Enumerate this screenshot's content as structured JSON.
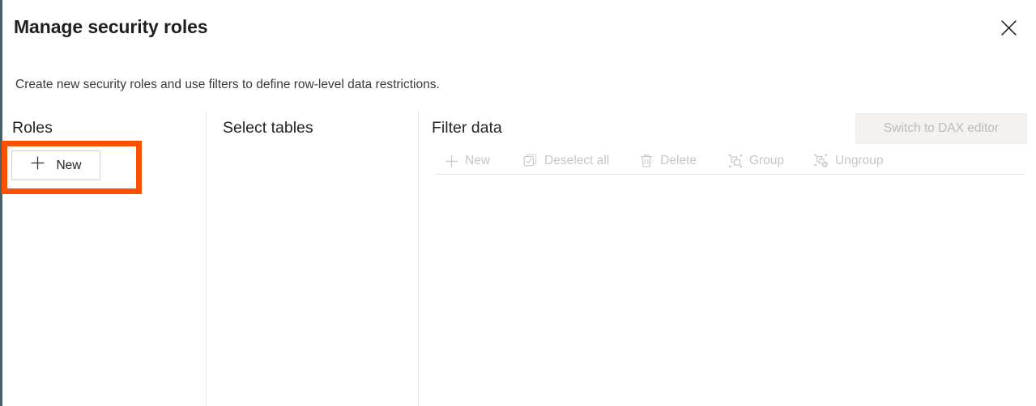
{
  "dialog": {
    "title": "Manage security roles",
    "subtitle": "Create new security roles and use filters to define row-level data restrictions.",
    "close_label": "Close",
    "close_icon": "close-icon",
    "accent_color": "#4b6069",
    "highlight_color": "#fa5000"
  },
  "columns": {
    "roles": {
      "heading": "Roles",
      "new_button": {
        "label": "New",
        "icon": "plus-icon"
      }
    },
    "tables": {
      "heading": "Select tables"
    },
    "filter": {
      "heading": "Filter data",
      "dax_button": {
        "label": "Switch to DAX editor",
        "disabled": true
      },
      "toolbar": [
        {
          "label": "New",
          "icon": "plus-icon",
          "disabled": true
        },
        {
          "label": "Deselect all",
          "icon": "deselect-all-icon",
          "disabled": true
        },
        {
          "label": "Delete",
          "icon": "trash-icon",
          "disabled": true
        },
        {
          "label": "Group",
          "icon": "group-icon",
          "disabled": true
        },
        {
          "label": "Ungroup",
          "icon": "ungroup-icon",
          "disabled": true
        }
      ]
    }
  }
}
